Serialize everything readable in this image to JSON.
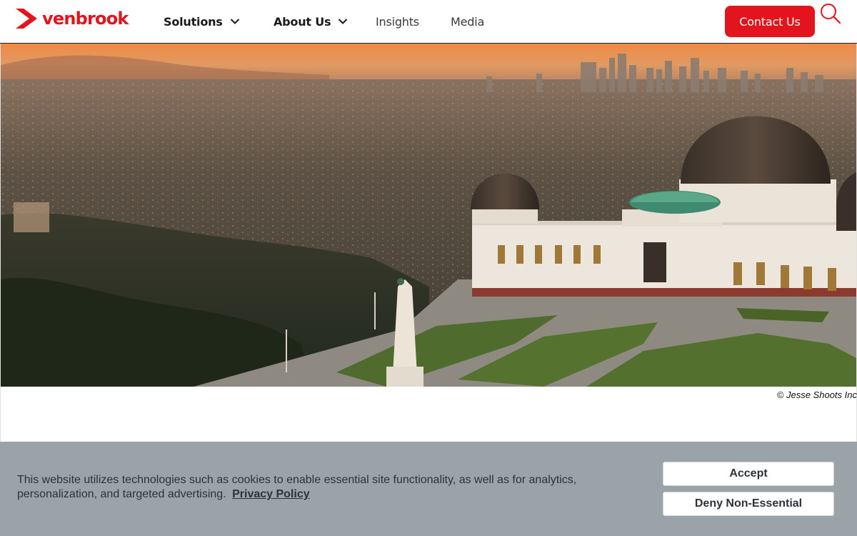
{
  "brand": {
    "name": "venbrook",
    "accent_color": "#e3141e"
  },
  "nav": {
    "items": [
      {
        "label": "Solutions",
        "has_dropdown": true
      },
      {
        "label": "About Us",
        "has_dropdown": true
      },
      {
        "label": "Insights",
        "has_dropdown": false
      },
      {
        "label": "Media",
        "has_dropdown": false
      }
    ],
    "contact_label": "Contact Us",
    "search_icon": "search-icon"
  },
  "hero": {
    "image": "Griffith Observatory overlooking Los Angeles at sunset",
    "credit": "© Jesse Shoots Inc"
  },
  "cookie_banner": {
    "text": "This website utilizes technologies such as cookies to enable essential site functionality, as well as for analytics, personalization, and targeted advertising.",
    "link_label": "Privacy Policy",
    "accept_label": "Accept",
    "deny_label": "Deny Non-Essential",
    "background_color": "#9aa3a7"
  }
}
